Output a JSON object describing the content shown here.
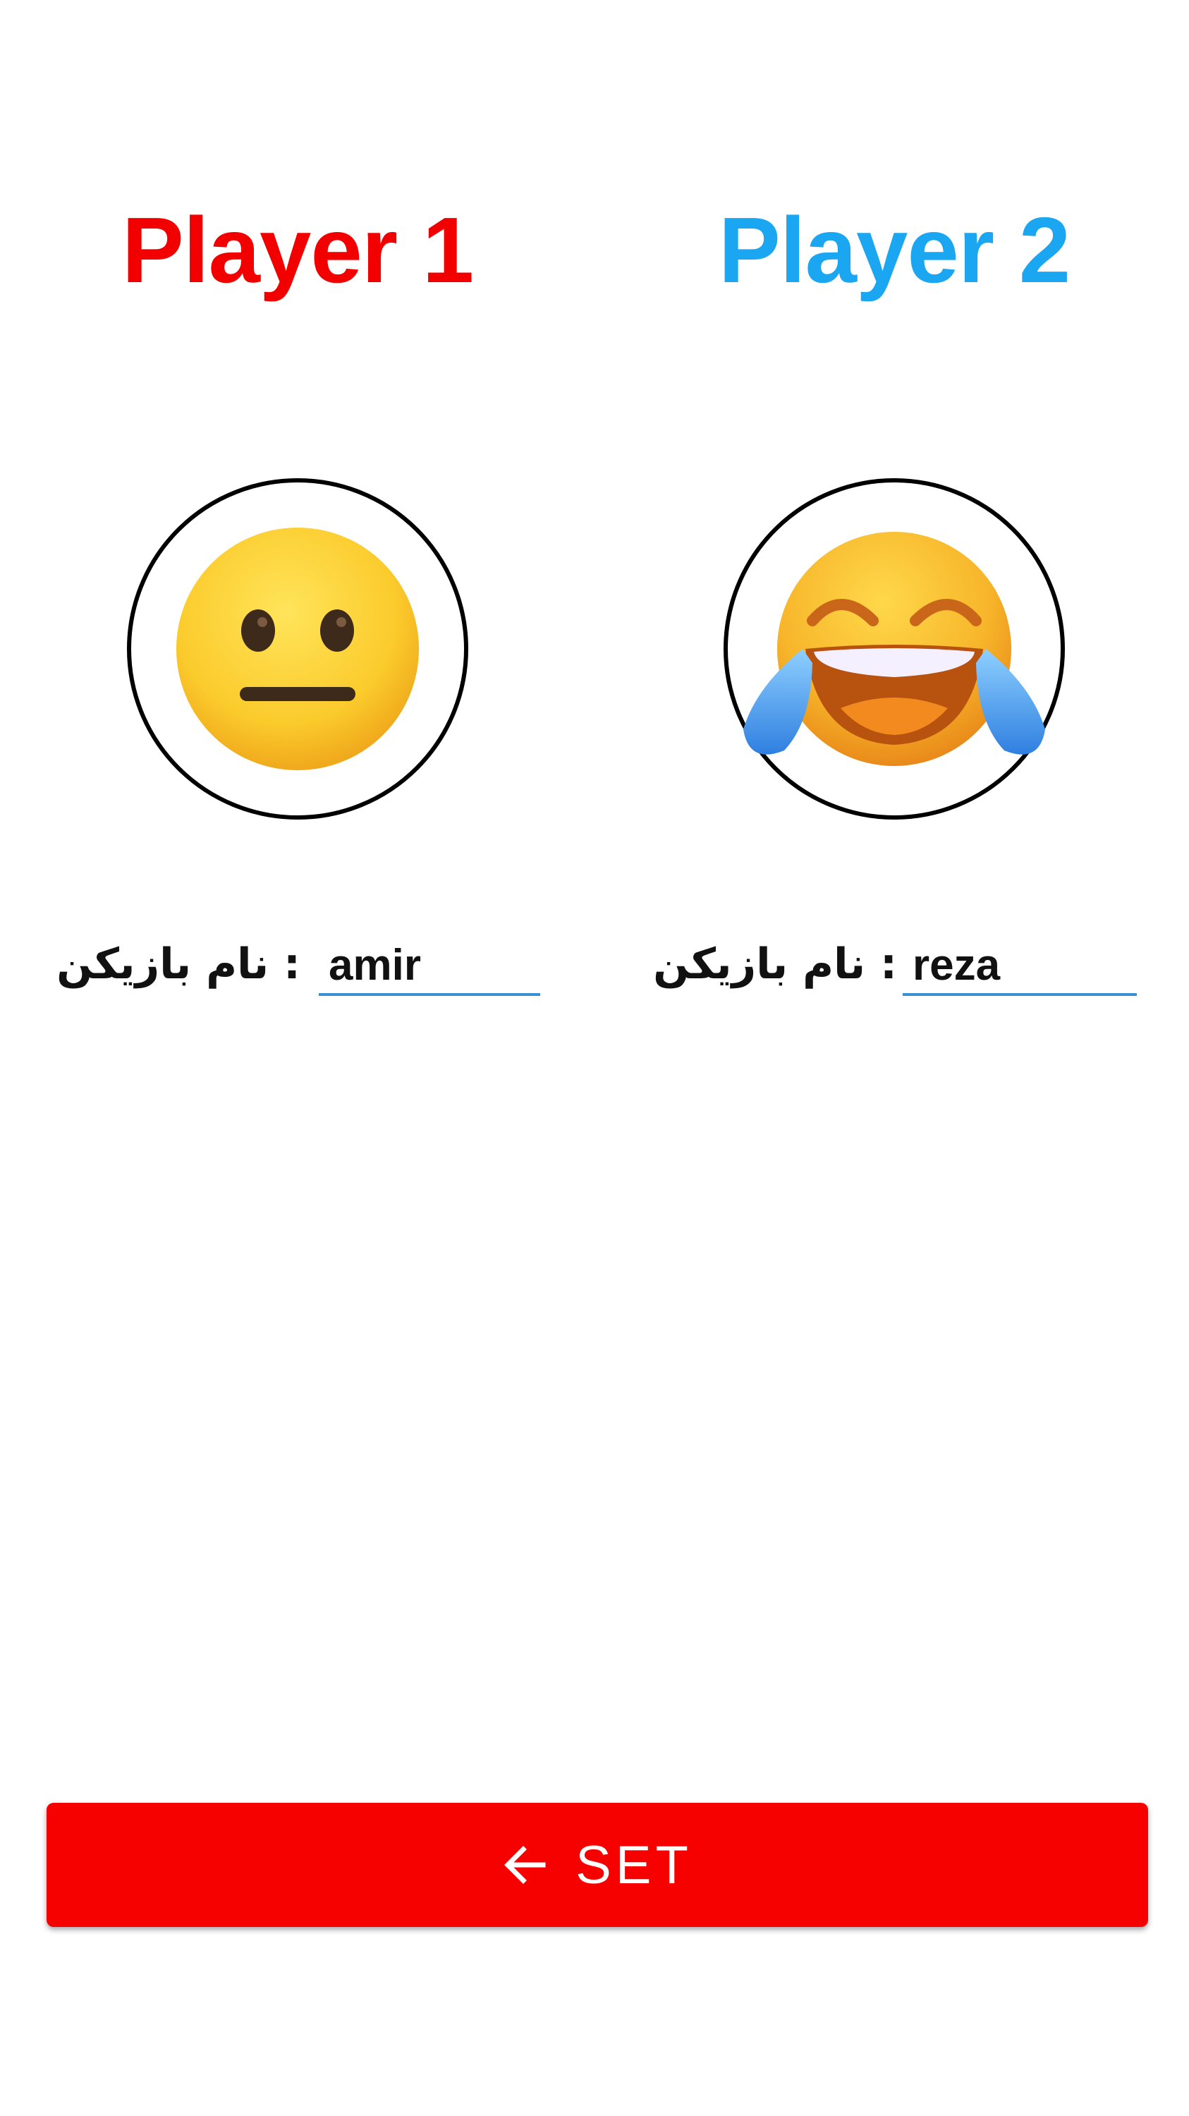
{
  "players": [
    {
      "title": "Player 1",
      "title_color": "#f20000",
      "avatar_icon": "neutral-face-emoji",
      "name_label": ": نام بازیکن",
      "name_value": "amir"
    },
    {
      "title": "Player 2",
      "title_color": "#1aa6f0",
      "avatar_icon": "tears-of-joy-emoji",
      "name_label": ": نام بازیکن",
      "name_value": "reza"
    }
  ],
  "set_button": {
    "label": "SET",
    "icon": "arrow-left-icon",
    "color": "#f60000"
  },
  "colors": {
    "input_underline": "#3a8fd6",
    "background": "#ffffff"
  }
}
